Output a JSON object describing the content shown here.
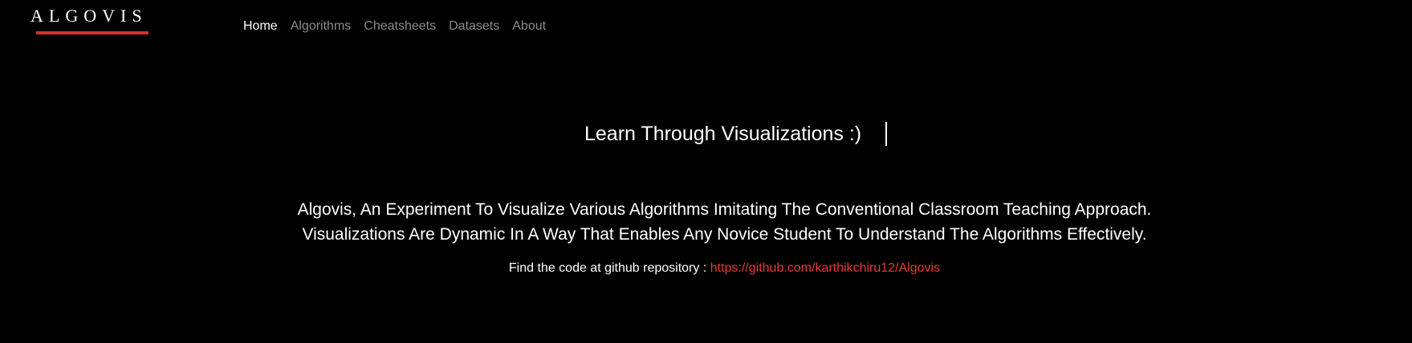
{
  "brand": {
    "logo_text": "ALGOVIS",
    "accent_color": "#d32f2f"
  },
  "nav": {
    "items": [
      {
        "label": "Home",
        "active": true
      },
      {
        "label": "Algorithms",
        "active": false
      },
      {
        "label": "Cheatsheets",
        "active": false
      },
      {
        "label": "Datasets",
        "active": false
      },
      {
        "label": "About",
        "active": false
      }
    ]
  },
  "hero": {
    "headline": "Learn Through Visualizations :)",
    "description_line1": "Algovis, An Experiment To Visualize Various Algorithms Imitating The Conventional Classroom Teaching Approach.",
    "description_line2": "Visualizations Are Dynamic In A Way That Enables Any Novice Student To Understand The Algorithms Effectively.",
    "repo_prefix": "Find the code at github repository : ",
    "repo_link": "https://github.com/karthikchiru12/Algovis",
    "link_color": "#e53935"
  }
}
